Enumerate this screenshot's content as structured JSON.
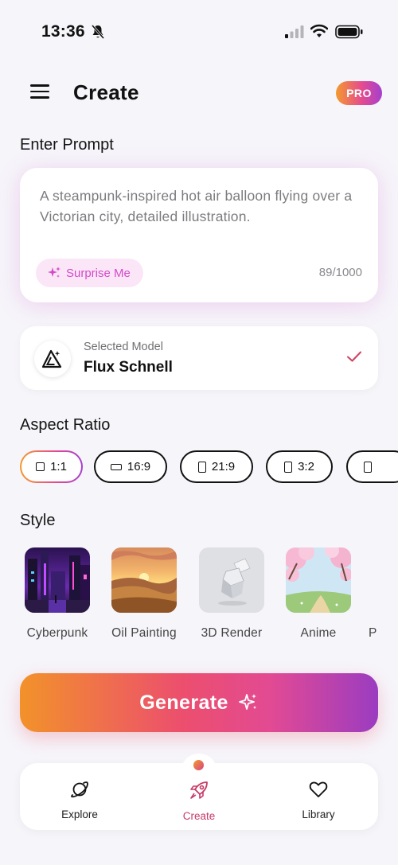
{
  "status_bar": {
    "time": "13:36"
  },
  "header": {
    "title": "Create",
    "pro_badge": "PRO"
  },
  "prompt": {
    "section_label": "Enter Prompt",
    "text": "A steampunk-inspired hot air balloon flying over a Victorian city, detailed illustration.",
    "surprise_label": "Surprise Me",
    "counter": "89/1000"
  },
  "model": {
    "caption": "Selected Model",
    "name": "Flux Schnell"
  },
  "aspect": {
    "section_label": "Aspect Ratio",
    "options": [
      "1:1",
      "16:9",
      "21:9",
      "3:2"
    ],
    "selected": "1:1"
  },
  "style": {
    "section_label": "Style",
    "items": [
      {
        "label": "Cyberpunk"
      },
      {
        "label": "Oil Painting"
      },
      {
        "label": "3D Render"
      },
      {
        "label": "Anime"
      },
      {
        "label": "P"
      }
    ]
  },
  "generate": {
    "label": "Generate"
  },
  "nav": {
    "items": [
      {
        "label": "Explore",
        "icon": "planet-icon"
      },
      {
        "label": "Create",
        "icon": "rocket-icon"
      },
      {
        "label": "Library",
        "icon": "heart-icon"
      }
    ],
    "active": "Create"
  },
  "colors": {
    "accent_pink": "#e64c8d",
    "accent_orange": "#f39a2f",
    "accent_purple": "#a43fd0",
    "background": "#f6f5fa"
  }
}
